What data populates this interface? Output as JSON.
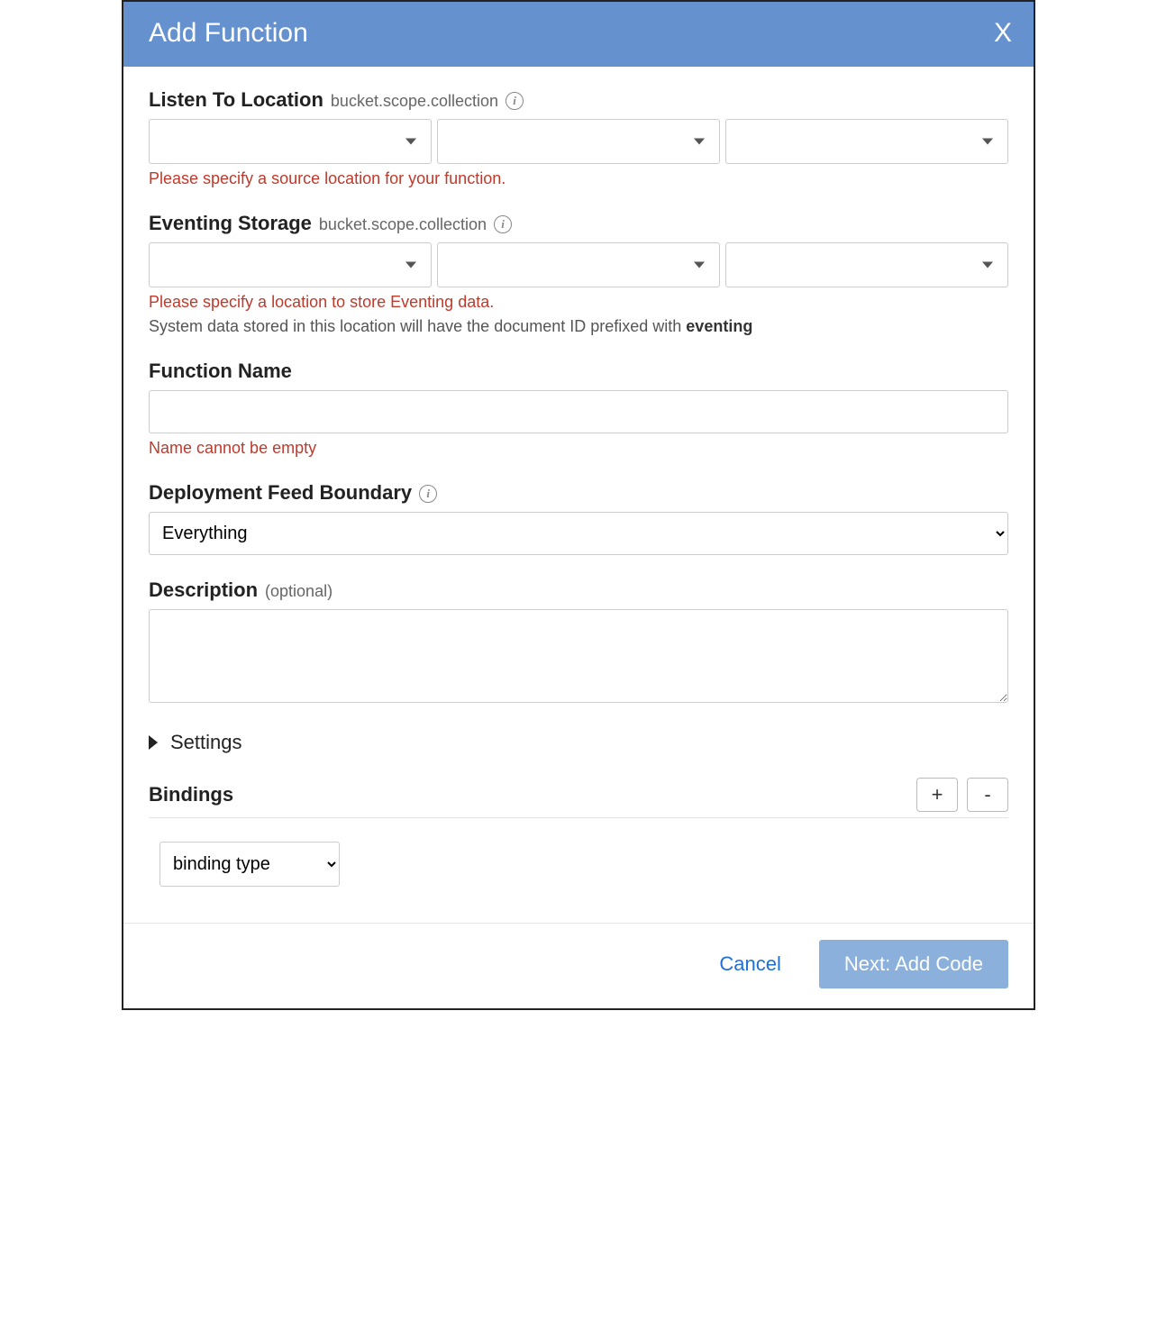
{
  "header": {
    "title": "Add Function",
    "close": "X"
  },
  "listen": {
    "label": "Listen To Location",
    "sublabel": "bucket.scope.collection",
    "error": "Please specify a source location for your function."
  },
  "storage": {
    "label": "Eventing Storage",
    "sublabel": "bucket.scope.collection",
    "error": "Please specify a location to store Eventing data.",
    "help_prefix": "System data stored in this location will have the document ID prefixed with ",
    "help_bold": "eventing"
  },
  "function_name": {
    "label": "Function Name",
    "value": "",
    "error": "Name cannot be empty"
  },
  "boundary": {
    "label": "Deployment Feed Boundary",
    "selected": "Everything"
  },
  "description": {
    "label": "Description",
    "optional": "(optional)",
    "value": ""
  },
  "settings": {
    "label": "Settings"
  },
  "bindings": {
    "label": "Bindings",
    "add": "+",
    "remove": "-",
    "type_selected": "binding type"
  },
  "footer": {
    "cancel": "Cancel",
    "next": "Next: Add Code"
  },
  "icons": {
    "info": "i"
  }
}
